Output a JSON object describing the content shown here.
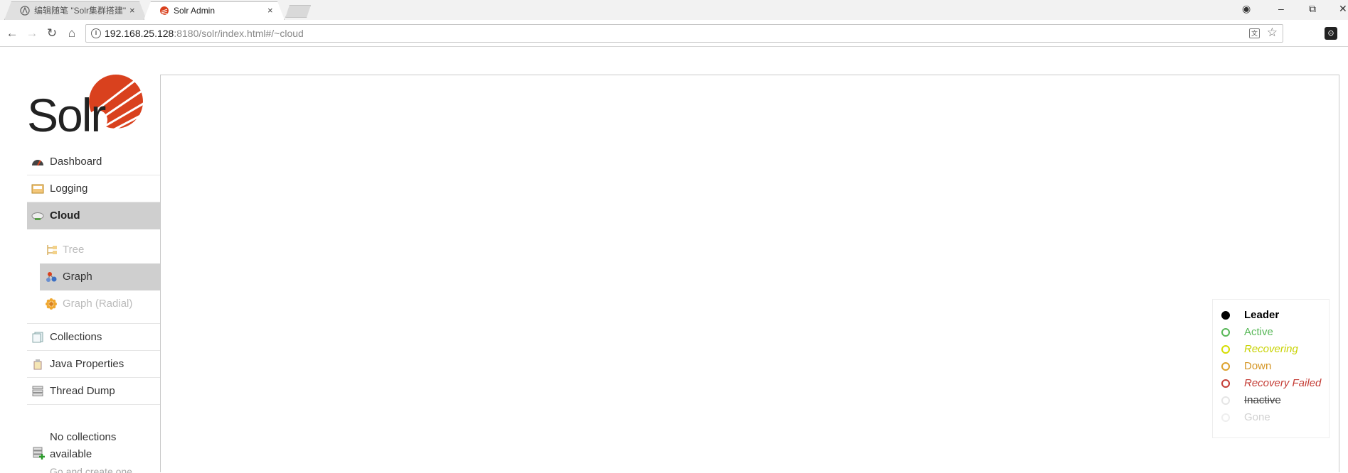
{
  "browser": {
    "tabs": [
      {
        "title": "编辑随笔 \"Solr集群搭建\"",
        "active": false,
        "close": "×"
      },
      {
        "title": "Solr Admin",
        "active": true,
        "close": "×"
      }
    ],
    "window_controls": {
      "profile": "◉",
      "minimize": "–",
      "restore": "⧉",
      "close": "✕"
    },
    "nav": {
      "back": "←",
      "forward": "→",
      "reload": "↻",
      "home": "⌂"
    },
    "address": {
      "host": "192.168.25.128",
      "rest": ":8180/solr/index.html#/~cloud"
    },
    "translate_label": "文",
    "star": "☆",
    "extension_label": "⊙"
  },
  "sidebar": {
    "items": [
      {
        "label": "Dashboard",
        "icon": "dashboard-icon"
      },
      {
        "label": "Logging",
        "icon": "logging-icon"
      },
      {
        "label": "Cloud",
        "icon": "cloud-icon",
        "selected": true
      },
      {
        "label": "Collections",
        "icon": "collections-icon"
      },
      {
        "label": "Java Properties",
        "icon": "java-properties-icon"
      },
      {
        "label": "Thread Dump",
        "icon": "thread-dump-icon"
      }
    ],
    "cloud_subitems": [
      {
        "label": "Tree",
        "icon": "tree-icon",
        "enabled": false
      },
      {
        "label": "Graph",
        "icon": "graph-icon",
        "selected": true
      },
      {
        "label": "Graph (Radial)",
        "icon": "graph-radial-icon",
        "enabled": false
      }
    ],
    "no_collections": "No collections available",
    "no_collections_hint": "Go and create one"
  },
  "legend": {
    "items": [
      {
        "label": "Leader",
        "color": "#000000",
        "filled": true,
        "style": "bold"
      },
      {
        "label": "Active",
        "color": "#57b757",
        "filled": false,
        "style": "normal"
      },
      {
        "label": "Recovering",
        "color": "#d5dd00",
        "filled": false,
        "style": "italic"
      },
      {
        "label": "Down",
        "color": "#dca12b",
        "filled": false,
        "style": "normal"
      },
      {
        "label": "Recovery Failed",
        "color": "#c43c35",
        "filled": false,
        "style": "italic"
      },
      {
        "label": "Inactive",
        "color": "#555555",
        "filled": false,
        "style": "strike"
      },
      {
        "label": "Gone",
        "color": "#d0d0d0",
        "filled": false,
        "style": "normal"
      }
    ]
  },
  "colors": {
    "selected_bg": "#cfcfcf",
    "solr_red": "#d9411e"
  }
}
